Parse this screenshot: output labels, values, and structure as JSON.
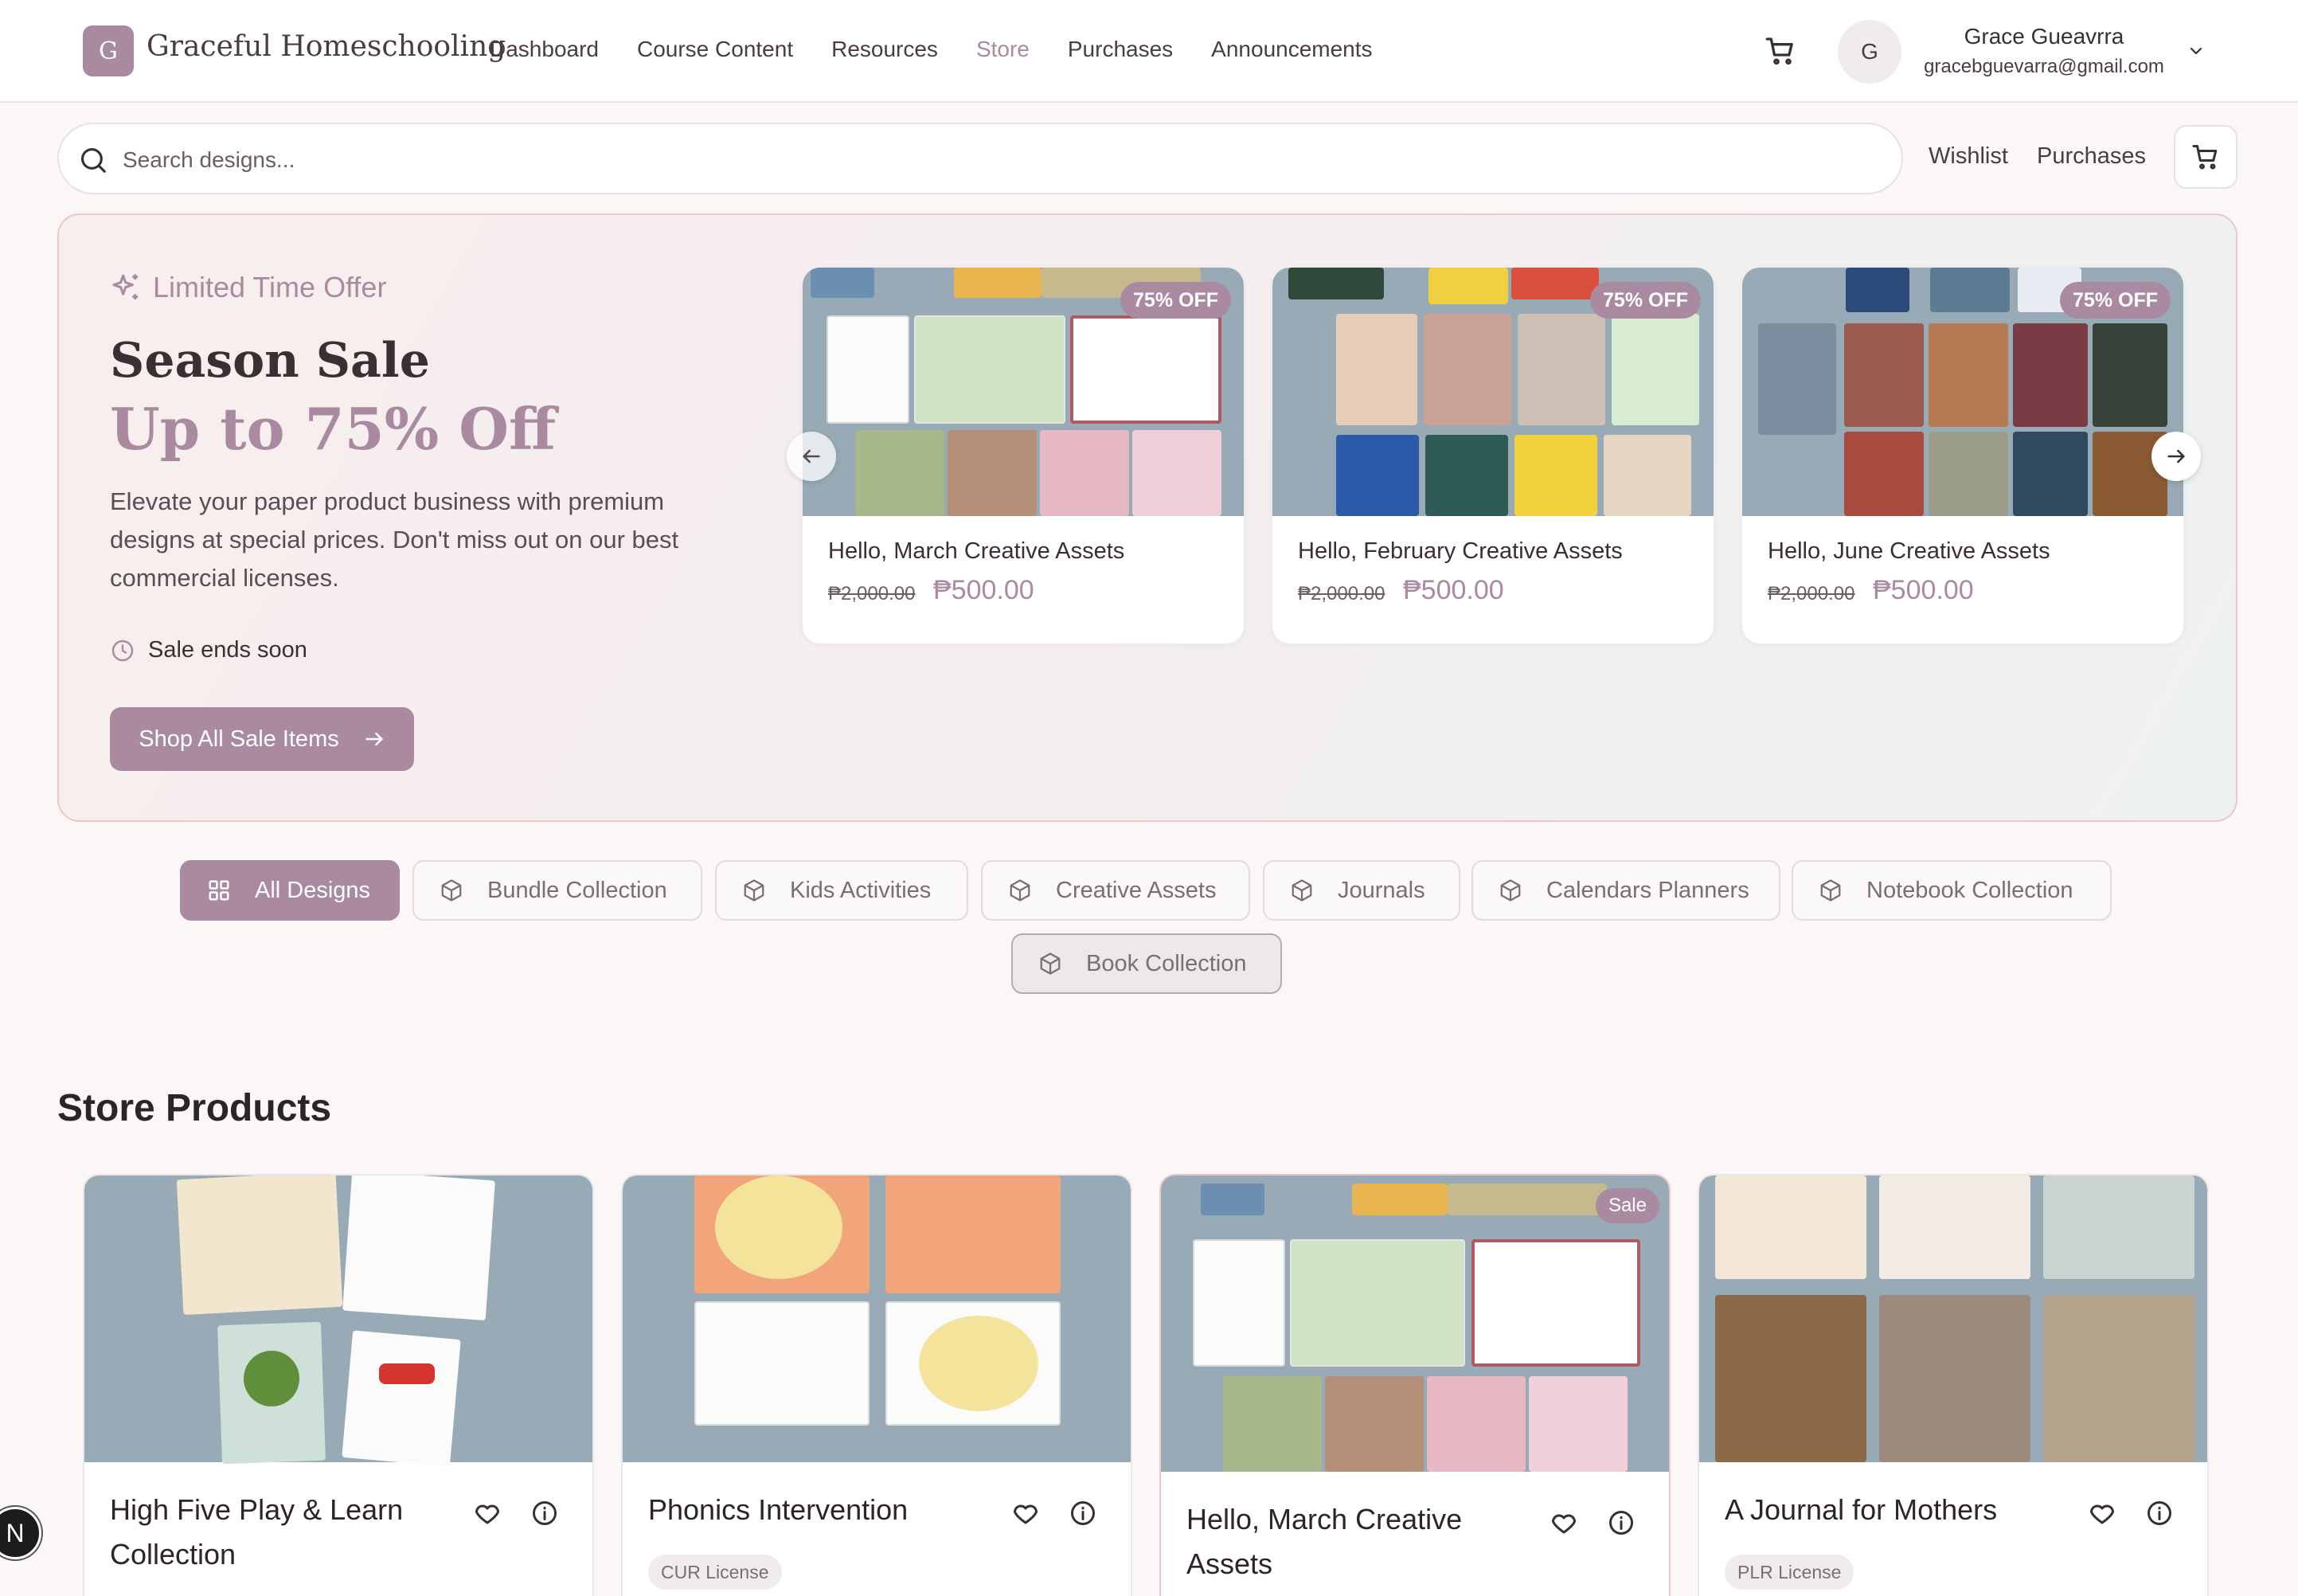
{
  "brand": {
    "logo_letter": "G",
    "name": "Graceful Homeschooling"
  },
  "nav": {
    "items": [
      {
        "label": "Dashboard"
      },
      {
        "label": "Course Content"
      },
      {
        "label": "Resources"
      },
      {
        "label": "Store",
        "active": true
      },
      {
        "label": "Purchases"
      },
      {
        "label": "Announcements"
      }
    ]
  },
  "user": {
    "initial": "G",
    "name": "Grace Gueavrra",
    "email": "gracebguevarra@gmail.com"
  },
  "search": {
    "placeholder": "Search designs..."
  },
  "subnav": {
    "wishlist": "Wishlist",
    "purchases": "Purchases"
  },
  "banner": {
    "eyebrow": "Limited Time Offer",
    "title": "Season Sale",
    "subtitle": "Up to 75% Off",
    "description": "Elevate your paper product business with premium designs at special prices. Don't miss out on our best commercial licenses.",
    "ends": "Sale ends soon",
    "cta": "Shop All Sale Items",
    "cards": [
      {
        "name": "Hello, March Creative Assets",
        "badge": "75% OFF",
        "old_price": "₱2,000.00",
        "price": "₱500.00"
      },
      {
        "name": "Hello, February Creative Assets",
        "badge": "75% OFF",
        "old_price": "₱2,000.00",
        "price": "₱500.00"
      },
      {
        "name": "Hello, June Creative Assets",
        "badge": "75% OFF",
        "old_price": "₱2,000.00",
        "price": "₱500.00"
      }
    ]
  },
  "categories": [
    {
      "label": "All Designs",
      "active": true
    },
    {
      "label": "Bundle Collection"
    },
    {
      "label": "Kids Activities"
    },
    {
      "label": "Creative Assets"
    },
    {
      "label": "Journals"
    },
    {
      "label": "Calendars Planners"
    },
    {
      "label": "Notebook Collection"
    },
    {
      "label": "Book Collection"
    }
  ],
  "products_title": "Store Products",
  "products": [
    {
      "name": "High Five Play & Learn Collection",
      "license": ""
    },
    {
      "name": "Phonics Intervention",
      "license": "CUR License"
    },
    {
      "name": "Hello, March Creative Assets",
      "license": "",
      "tag": "Sale"
    },
    {
      "name": "A Journal for Mothers",
      "license": "PLR License"
    }
  ],
  "floating_badge": "N",
  "colors": {
    "accent": "#a98aa1",
    "image_bg": "#97aab5",
    "border_pink": "#ecc6cc"
  }
}
